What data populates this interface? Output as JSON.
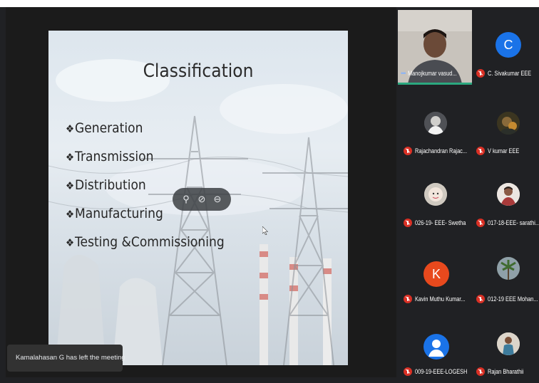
{
  "slide": {
    "title": "Classification",
    "bullets": [
      "Generation",
      "Transmission",
      "Distribution",
      "Manufacturing",
      "Testing &Commissioning"
    ],
    "bullet_marker": "❖"
  },
  "pin_controls": {
    "icons": [
      "pin-icon",
      "mute-icon",
      "remove-icon"
    ],
    "glyphs": [
      "⚲",
      "⊘",
      "⊖"
    ]
  },
  "toast": {
    "message": "Kamalahasan G has left the meeting"
  },
  "participants": [
    {
      "name": "Manojkumar vasud...",
      "muted": false,
      "speaking": true,
      "avatar": "video"
    },
    {
      "name": "C. Sivakumar EEE",
      "muted": true,
      "avatar": "letter",
      "letter": "C",
      "color": "#1a73e8"
    },
    {
      "name": "Rajachandran Rajac...",
      "muted": true,
      "avatar": "photo"
    },
    {
      "name": "V kumar EEE",
      "muted": true,
      "avatar": "photo"
    },
    {
      "name": "026-19- EEE- Swetha",
      "muted": true,
      "avatar": "photo"
    },
    {
      "name": "017-18-EEE- sarathi...",
      "muted": true,
      "avatar": "photo"
    },
    {
      "name": "Kavin Muthu Kumar...",
      "muted": true,
      "avatar": "letter",
      "letter": "K",
      "color": "#e8491d"
    },
    {
      "name": "012-19 EEE Mohan...",
      "muted": true,
      "avatar": "photo"
    },
    {
      "name": "009-19-EEE-LOGESH",
      "muted": true,
      "avatar": "default"
    },
    {
      "name": "Rajan Bharathii",
      "muted": true,
      "avatar": "photo"
    }
  ],
  "colors": {
    "background": "#202124",
    "muted_red": "#d93025",
    "active_border": "#2ba87f"
  }
}
